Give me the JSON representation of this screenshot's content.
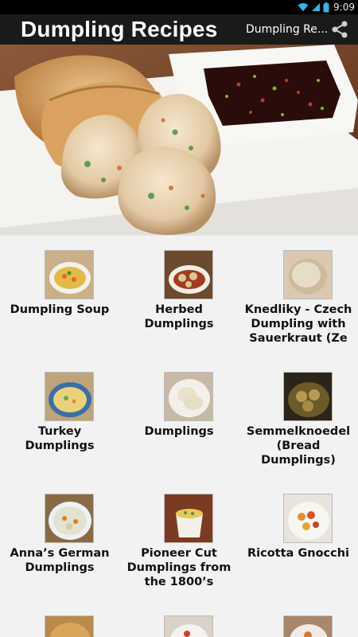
{
  "status_bar": {
    "time": "9:09"
  },
  "action_bar": {
    "title": "Dumpling Recipes",
    "subtitle": "Dumpling Re...",
    "share_icon": "share-icon"
  },
  "recipes": [
    {
      "label": "Dumpling Soup"
    },
    {
      "label": "Herbed Dumplings"
    },
    {
      "label": "Knedliky - Czech Dumpling with Sauerkraut (Ze"
    },
    {
      "label": "Turkey Dumplings"
    },
    {
      "label": "Dumplings"
    },
    {
      "label": "Semmelknoedel (Bread Dumplings)"
    },
    {
      "label": "Anna’s German Dumplings"
    },
    {
      "label": "Pioneer Cut Dumplings from the 1800’s"
    },
    {
      "label": "Ricotta Gnocchi"
    },
    {
      "label": ""
    },
    {
      "label": ""
    },
    {
      "label": ""
    }
  ]
}
